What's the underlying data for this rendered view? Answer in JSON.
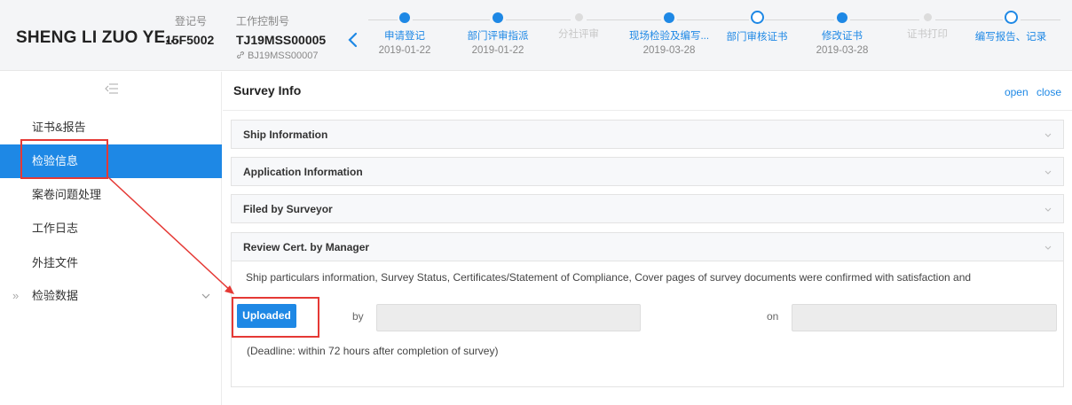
{
  "header": {
    "ship_name": "SHENG LI ZUO YE...",
    "reg_label": "登记号",
    "reg_value": "15F5002",
    "ctrl_label": "工作控制号",
    "ctrl_value": "TJ19MSS00005",
    "ctrl_sub": "BJ19MSS00007"
  },
  "steps": [
    {
      "name": "申请登记",
      "date": "2019-01-22",
      "state": "done"
    },
    {
      "name": "部门评审指派",
      "date": "2019-01-22",
      "state": "done"
    },
    {
      "name": "分社评审",
      "date": "",
      "state": "disabled"
    },
    {
      "name": "现场检验及编写...",
      "date": "2019-03-28",
      "state": "done"
    },
    {
      "name": "部门审核证书",
      "date": "",
      "state": "current"
    },
    {
      "name": "修改证书",
      "date": "2019-03-28",
      "state": "done"
    },
    {
      "name": "证书打印",
      "date": "",
      "state": "disabled"
    },
    {
      "name": "编写报告、记录",
      "date": "",
      "state": "current"
    }
  ],
  "sidebar": {
    "items": [
      {
        "label": "证书&报告"
      },
      {
        "label": "检验信息"
      },
      {
        "label": "案卷问题处理"
      },
      {
        "label": "工作日志"
      },
      {
        "label": "外挂文件"
      },
      {
        "label": "检验数据"
      }
    ]
  },
  "main": {
    "title": "Survey Info",
    "open_label": "open",
    "close_label": "close",
    "panels": [
      {
        "title": "Ship Information"
      },
      {
        "title": "Application Information"
      },
      {
        "title": "Filed by Surveyor"
      },
      {
        "title": "Review Cert. by Manager"
      }
    ],
    "review": {
      "text": "Ship particulars information, Survey Status, Certificates/Statement of Compliance, Cover pages of survey documents were confirmed with satisfaction and",
      "button_label": "Uploaded",
      "by_label": "by",
      "by_value": "",
      "on_label": "on",
      "on_value": "",
      "deadline": "(Deadline: within 72 hours after completion of survey)"
    }
  },
  "colors": {
    "accent": "#1e88e5",
    "annotation": "#e53935"
  }
}
